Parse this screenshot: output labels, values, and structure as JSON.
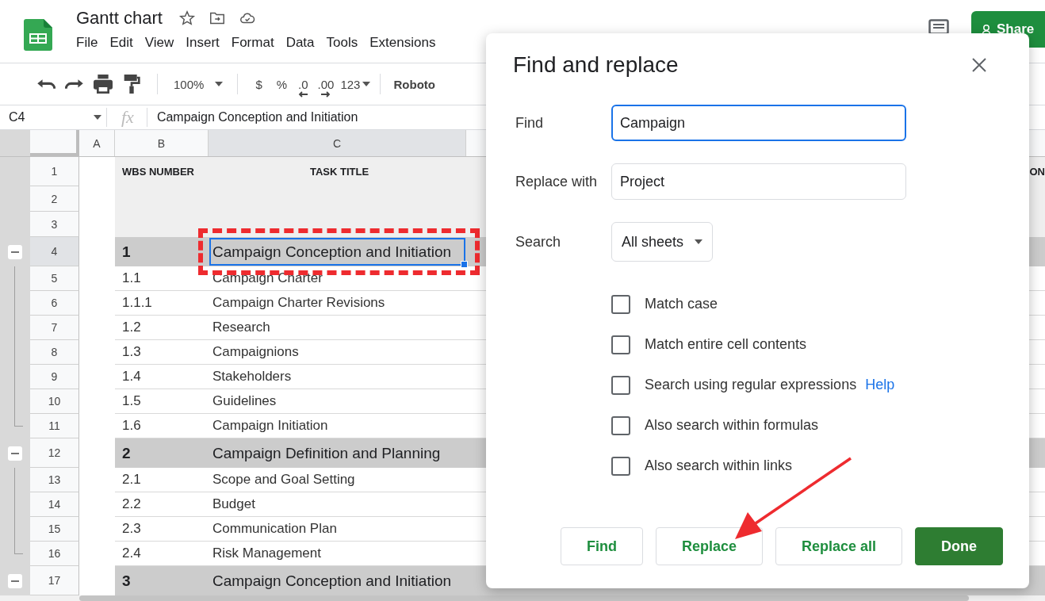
{
  "app": {
    "title": "Gantt chart",
    "menu": [
      "File",
      "Edit",
      "View",
      "Insert",
      "Format",
      "Data",
      "Tools",
      "Extensions"
    ],
    "share_button": "Share"
  },
  "toolbar": {
    "zoom": "100%",
    "currency": "$",
    "percent": "%",
    "decrease_decimals": ".0",
    "increase_decimals": ".00",
    "number_format": "123",
    "font": "Roboto"
  },
  "formula_bar": {
    "cell_ref": "C4",
    "fx": "fx",
    "value": "Campaign Conception and Initiation"
  },
  "sheet": {
    "columns": [
      {
        "label": "A",
        "selected": false
      },
      {
        "label": "B",
        "selected": false
      },
      {
        "label": "C",
        "selected": true
      }
    ],
    "rows": [
      {
        "number": "1",
        "kind": "header",
        "wbs": "WBS NUMBER",
        "title": "TASK TITLE",
        "column_4": "ON",
        "selected": false
      },
      {
        "number": "2",
        "kind": "blank",
        "selected": false
      },
      {
        "number": "3",
        "kind": "blank",
        "selected": false
      },
      {
        "number": "4",
        "kind": "group",
        "expanded": true,
        "wbs": "1",
        "title": "Campaign Conception and Initiation",
        "selected": true
      },
      {
        "number": "5",
        "kind": "item",
        "wbs": "1.1",
        "title": "Campaign Charter",
        "selected": false
      },
      {
        "number": "6",
        "kind": "item",
        "wbs": "1.1.1",
        "title": "Campaign Charter Revisions",
        "selected": false
      },
      {
        "number": "7",
        "kind": "item",
        "wbs": "1.2",
        "title": "Research",
        "selected": false
      },
      {
        "number": "8",
        "kind": "item",
        "wbs": "1.3",
        "title": "Campaignions",
        "selected": false
      },
      {
        "number": "9",
        "kind": "item",
        "wbs": "1.4",
        "title": "Stakeholders",
        "selected": false
      },
      {
        "number": "10",
        "kind": "item",
        "wbs": "1.5",
        "title": "Guidelines",
        "selected": false
      },
      {
        "number": "11",
        "kind": "item",
        "wbs": "1.6",
        "title": "Campaign Initiation",
        "selected": false
      },
      {
        "number": "12",
        "kind": "group",
        "expanded": true,
        "wbs": "2",
        "title": "Campaign Definition and Planning",
        "selected": false
      },
      {
        "number": "13",
        "kind": "item",
        "wbs": "2.1",
        "title": "Scope and Goal Setting",
        "selected": false
      },
      {
        "number": "14",
        "kind": "item",
        "wbs": "2.2",
        "title": "Budget",
        "selected": false
      },
      {
        "number": "15",
        "kind": "item",
        "wbs": "2.3",
        "title": "Communication Plan",
        "selected": false
      },
      {
        "number": "16",
        "kind": "item",
        "wbs": "2.4",
        "title": "Risk Management",
        "selected": false
      },
      {
        "number": "17",
        "kind": "group",
        "expanded": true,
        "wbs": "3",
        "title": "Campaign Conception and Initiation",
        "selected": false
      }
    ]
  },
  "dialog": {
    "title": "Find and replace",
    "fields": [
      {
        "label": "Find",
        "value": "Campaign",
        "focused": true
      },
      {
        "label": "Replace with",
        "value": "Project",
        "focused": false
      }
    ],
    "search": {
      "label": "Search",
      "value": "All sheets"
    },
    "options": [
      {
        "label": "Match case",
        "checked": false
      },
      {
        "label": "Match entire cell contents",
        "checked": false
      },
      {
        "label": "Search using regular expressions",
        "checked": false,
        "link": "Help"
      },
      {
        "label": "Also search within formulas",
        "checked": false
      },
      {
        "label": "Also search within links",
        "checked": false
      }
    ],
    "buttons": [
      {
        "label": "Find",
        "primary": false
      },
      {
        "label": "Replace",
        "primary": false
      },
      {
        "label": "Replace all",
        "primary": false
      },
      {
        "label": "Done",
        "primary": true
      }
    ]
  }
}
